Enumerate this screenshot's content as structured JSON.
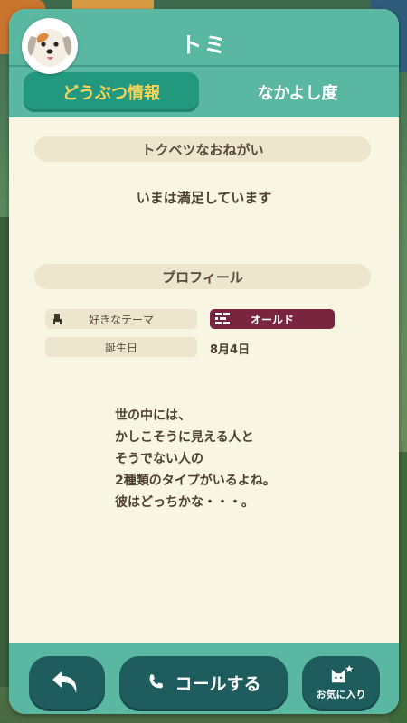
{
  "header": {
    "title": "トミ",
    "tabs": [
      {
        "label": "どうぶつ情報",
        "active": true
      },
      {
        "label": "なかよし度",
        "active": false
      }
    ]
  },
  "avatar": {
    "icon": "dog-villager-icon"
  },
  "special_request": {
    "heading": "トクベツなおねがい",
    "text": "いまは満足しています"
  },
  "profile": {
    "heading": "プロフィール",
    "favorite_theme": {
      "label": "好きなテーマ",
      "value": "オールド",
      "icon": "chair-icon",
      "value_icon": "brick-icon"
    },
    "birthday": {
      "label": "誕生日",
      "value": "8月4日"
    }
  },
  "quote_lines": [
    "世の中には、",
    "かしこそうに見える人と",
    "そうでない人の",
    "2種類のタイプがいるよね。",
    "彼はどっちかな・・・。"
  ],
  "footer": {
    "back_icon": "back-arrow-icon",
    "call_label": "コールする",
    "call_icon": "phone-icon",
    "favorite_label": "お気に入り",
    "favorite_icon": "cat-star-icon"
  },
  "colors": {
    "header": "#5ab8a2",
    "active_tab": "#22987f",
    "active_tab_text": "#f6d55a",
    "panel_bg": "#f8f5e3",
    "section_bar": "#ece6cf",
    "theme_badge": "#7a2540",
    "footer_button": "#1f5c5d"
  }
}
